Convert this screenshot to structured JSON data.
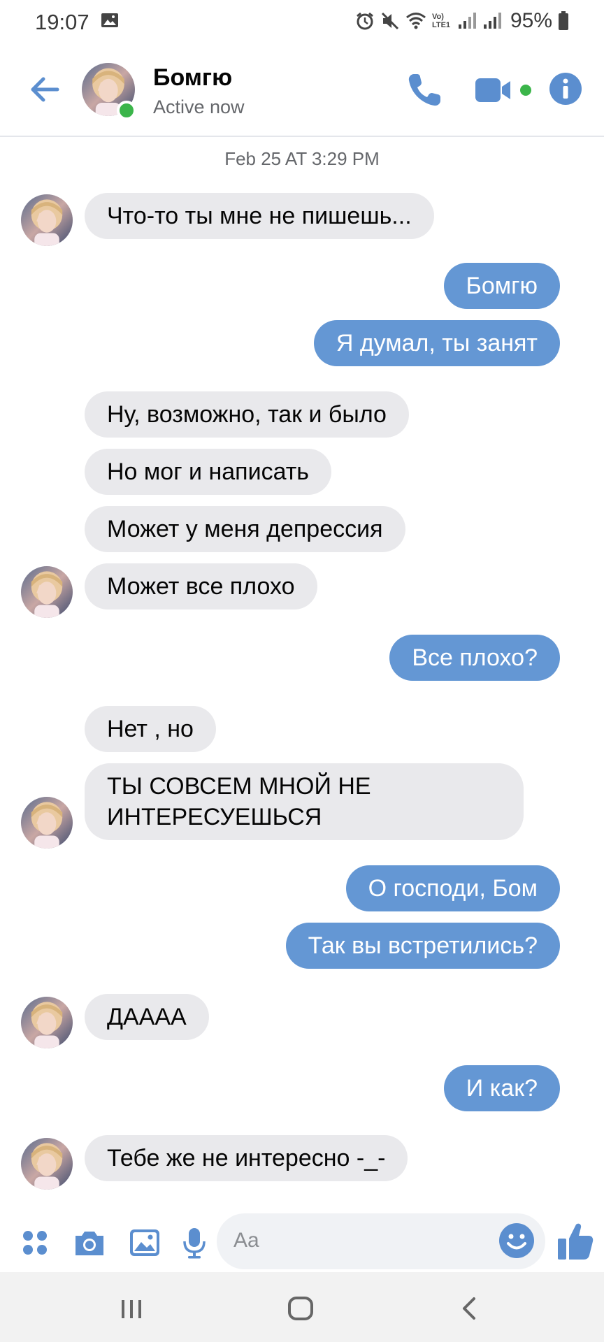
{
  "status_bar": {
    "time": "19:07",
    "battery_percent": "95%",
    "network_label": "Vo) LTE1",
    "icons": [
      "gallery-icon",
      "alarm-icon",
      "mute-icon",
      "wifi-icon",
      "signal-icon",
      "battery-icon"
    ]
  },
  "header": {
    "contact_name": "Бомгю",
    "contact_status": "Active now",
    "icons": [
      "back-arrow-icon",
      "phone-icon",
      "video-camera-icon",
      "info-icon"
    ]
  },
  "conversation": {
    "timestamp": "Feb 25 AT 3:29 PM",
    "messages": [
      {
        "direction": "in",
        "text": "Что-то ты мне не пишешь..."
      },
      {
        "direction": "out",
        "text": "Бомгю"
      },
      {
        "direction": "out",
        "text": "Я думал, ты занят"
      },
      {
        "direction": "in",
        "text": "Ну, возможно, так и было"
      },
      {
        "direction": "in",
        "text": "Но мог и написать"
      },
      {
        "direction": "in",
        "text": "Может у меня депрессия"
      },
      {
        "direction": "in",
        "text": "Может все плохо"
      },
      {
        "direction": "out",
        "text": "Все плохо?"
      },
      {
        "direction": "in",
        "text": "Нет , но"
      },
      {
        "direction": "in",
        "text": "ТЫ СОВСЕМ МНОЙ НЕ\nИНТЕРЕСУЕШЬСЯ"
      },
      {
        "direction": "out",
        "text": "О господи, Бом"
      },
      {
        "direction": "out",
        "text": "Так вы встретились?"
      },
      {
        "direction": "in",
        "text": "ДАААА"
      },
      {
        "direction": "out",
        "text": "И как?"
      },
      {
        "direction": "in",
        "text": "Тебе же не интересно -_-"
      }
    ]
  },
  "composer": {
    "placeholder": "Aa",
    "icons": [
      "apps-icon",
      "camera-icon",
      "gallery-icon",
      "microphone-icon",
      "emoji-icon",
      "thumbs-up-icon"
    ]
  },
  "colors": {
    "accent": "#5b8ecf",
    "outgoing_bubble": "#6497d4",
    "incoming_bubble": "#e9e9ec",
    "online": "#3bb54a"
  }
}
